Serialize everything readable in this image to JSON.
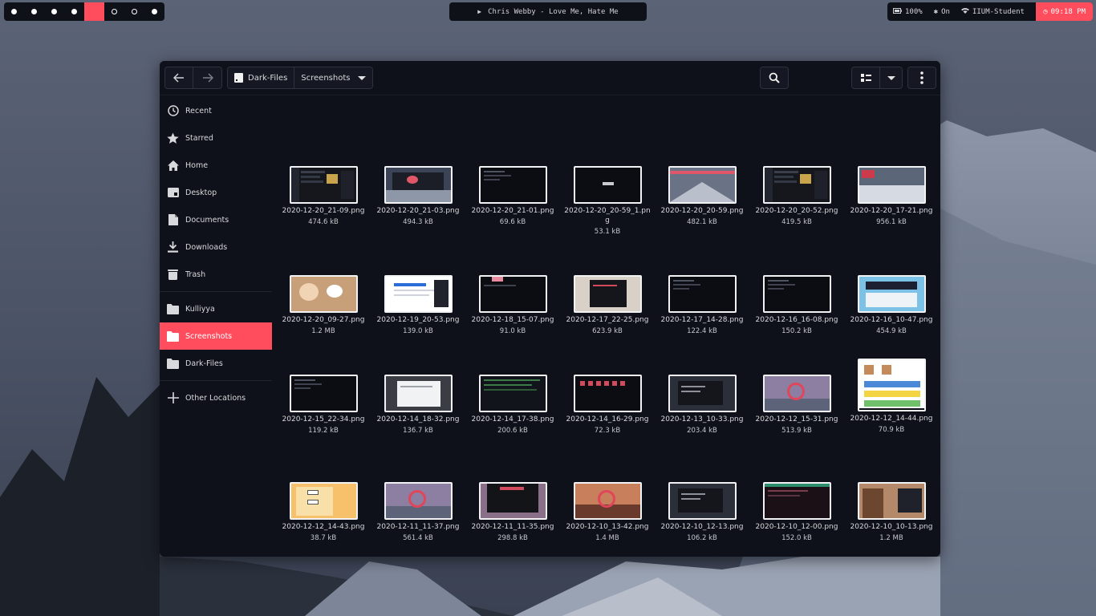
{
  "topbar": {
    "workspaces": [
      {
        "state": "filled"
      },
      {
        "state": "filled"
      },
      {
        "state": "filled"
      },
      {
        "state": "filled"
      },
      {
        "state": "active"
      },
      {
        "state": "hollow"
      },
      {
        "state": "hollow"
      },
      {
        "state": "filled"
      }
    ],
    "now_playing": "Chris Webby - Love Me, Hate Me",
    "battery": "100%",
    "bluetooth": "On",
    "wifi": "IIUM-Student",
    "clock": "09:18 PM",
    "accent": "#ff4d5e"
  },
  "window": {
    "path": [
      "Dark-Files",
      "Screenshots"
    ],
    "sidebar": [
      {
        "label": "Recent",
        "icon": "clock-icon"
      },
      {
        "label": "Starred",
        "icon": "star-icon"
      },
      {
        "label": "Home",
        "icon": "home-icon"
      },
      {
        "label": "Desktop",
        "icon": "desktop-icon"
      },
      {
        "label": "Documents",
        "icon": "document-icon"
      },
      {
        "label": "Downloads",
        "icon": "download-icon"
      },
      {
        "label": "Trash",
        "icon": "trash-icon"
      },
      {
        "label": "Kulliyya",
        "icon": "folder-icon"
      },
      {
        "label": "Screenshots",
        "icon": "folder-icon",
        "active": true
      },
      {
        "label": "Dark-Files",
        "icon": "folder-icon"
      },
      {
        "label": "Other Locations",
        "icon": "plus-icon"
      }
    ],
    "files": [
      {
        "name": "2020-12-20_21-09.png",
        "size": "474.6 kB",
        "theme": "dark-app"
      },
      {
        "name": "2020-12-20_21-03.png",
        "size": "494.3 kB",
        "theme": "mountain-app"
      },
      {
        "name": "2020-12-20_21-01.png",
        "size": "69.6 kB",
        "theme": "terminal"
      },
      {
        "name": "2020-12-20_20-59_1.png",
        "size": "53.1 kB",
        "theme": "clock"
      },
      {
        "name": "2020-12-20_20-59.png",
        "size": "482.1 kB",
        "theme": "mountain"
      },
      {
        "name": "2020-12-20_20-52.png",
        "size": "419.5 kB",
        "theme": "dark-app"
      },
      {
        "name": "2020-12-20_17-21.png",
        "size": "956.1 kB",
        "theme": "snow"
      },
      {
        "name": "2020-12-20_09-27.png",
        "size": "1.2 MB",
        "theme": "food"
      },
      {
        "name": "2020-12-19_20-53.png",
        "size": "139.0 kB",
        "theme": "white-doc"
      },
      {
        "name": "2020-12-18_15-07.png",
        "size": "91.0 kB",
        "theme": "terminal-pink"
      },
      {
        "name": "2020-12-17_22-25.png",
        "size": "623.9 kB",
        "theme": "desk"
      },
      {
        "name": "2020-12-17_14-28.png",
        "size": "122.4 kB",
        "theme": "terminal"
      },
      {
        "name": "2020-12-16_16-08.png",
        "size": "150.2 kB",
        "theme": "terminal"
      },
      {
        "name": "2020-12-16_10-47.png",
        "size": "454.9 kB",
        "theme": "blue-web"
      },
      {
        "name": "2020-12-15_22-34.png",
        "size": "119.2 kB",
        "theme": "terminal"
      },
      {
        "name": "2020-12-14_18-32.png",
        "size": "136.7 kB",
        "theme": "gray-dialog"
      },
      {
        "name": "2020-12-14_17-38.png",
        "size": "200.6 kB",
        "theme": "code-green"
      },
      {
        "name": "2020-12-14_16-29.png",
        "size": "72.3 kB",
        "theme": "icons-red"
      },
      {
        "name": "2020-12-13_10-33.png",
        "size": "203.4 kB",
        "theme": "dark-dialog"
      },
      {
        "name": "2020-12-12_15-31.png",
        "size": "513.9 kB",
        "theme": "sunset-ring"
      },
      {
        "name": "2020-12-12_14-44.png",
        "size": "70.9 kB",
        "theme": "diagram"
      },
      {
        "name": "2020-12-12_14-43.png",
        "size": "38.7 kB",
        "theme": "yellow-diagram"
      },
      {
        "name": "2020-12-11_11-37.png",
        "size": "561.4 kB",
        "theme": "sunset-ring"
      },
      {
        "name": "2020-12-11_11-35.png",
        "size": "298.8 kB",
        "theme": "sunset-app"
      },
      {
        "name": "2020-12-10_13-42.png",
        "size": "1.4 MB",
        "theme": "canyon-ring"
      },
      {
        "name": "2020-12-10_12-13.png",
        "size": "106.2 kB",
        "theme": "dark-dialog"
      },
      {
        "name": "2020-12-10_12-00.png",
        "size": "152.0 kB",
        "theme": "terminal-green"
      },
      {
        "name": "2020-12-10_10-13.png",
        "size": "1.2 MB",
        "theme": "person"
      },
      {
        "name": "",
        "size": "",
        "theme": "white-doc"
      },
      {
        "name": "",
        "size": "",
        "theme": "dark-app"
      },
      {
        "name": "",
        "size": "",
        "theme": "dark-app"
      },
      {
        "name": "",
        "size": "",
        "theme": "terminal"
      },
      {
        "name": "",
        "size": "",
        "theme": "terminal"
      },
      {
        "name": "",
        "size": "",
        "theme": "pink"
      },
      {
        "name": "",
        "size": "",
        "theme": "yellow-doc"
      }
    ]
  }
}
